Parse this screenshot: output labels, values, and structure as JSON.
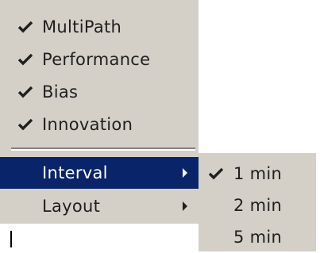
{
  "main_menu": {
    "items": [
      {
        "label": "MultiPath",
        "checked": true
      },
      {
        "label": "Performance",
        "checked": true
      },
      {
        "label": "Bias",
        "checked": true
      },
      {
        "label": "Innovation",
        "checked": true
      }
    ],
    "submenu_items": [
      {
        "label": "Interval",
        "selected": true,
        "has_submenu": true
      },
      {
        "label": "Layout",
        "selected": false,
        "has_submenu": true
      }
    ]
  },
  "interval_submenu": {
    "items": [
      {
        "label": "1 min",
        "checked": true
      },
      {
        "label": "2 min",
        "checked": false
      },
      {
        "label": "5 min",
        "checked": false
      }
    ]
  },
  "colors": {
    "menu_background": "#d4d0c8",
    "highlight": "#0a246a",
    "highlight_text": "#ffffff",
    "text": "#1f1f1f"
  }
}
